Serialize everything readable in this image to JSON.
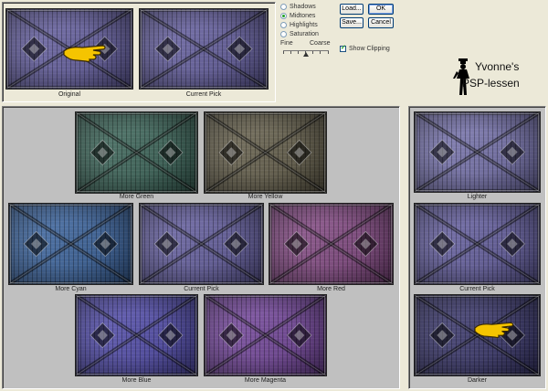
{
  "top": {
    "original_caption": "Original",
    "current_pick_caption": "Current Pick"
  },
  "controls": {
    "radios": [
      {
        "label": "Shadows",
        "selected": false
      },
      {
        "label": "Midtones",
        "selected": true
      },
      {
        "label": "Highlights",
        "selected": false
      },
      {
        "label": "Saturation",
        "selected": false
      }
    ],
    "buttons": {
      "load": "Load...",
      "ok": "OK",
      "save": "Save...",
      "cancel": "Cancel"
    },
    "slider": {
      "fine_label": "Fine",
      "coarse_label": "Coarse",
      "position": 0.5
    },
    "show_clipping": {
      "label": "Show Clipping",
      "checked": true
    }
  },
  "logo": {
    "line1": "Yvonne's",
    "line2": "PSP-lessen"
  },
  "variations": {
    "more_green": "More Green",
    "more_yellow": "More Yellow",
    "more_cyan": "More Cyan",
    "current_pick": "Current Pick",
    "more_red": "More Red",
    "more_blue": "More Blue",
    "more_magenta": "More Magenta"
  },
  "brightness": {
    "lighter": "Lighter",
    "current_pick": "Current Pick",
    "darker": "Darker"
  },
  "colors": {
    "original": "#6a64a8",
    "current": "#6a64a8",
    "green": "#3f6b5e",
    "yellow": "#6b6550",
    "cyan": "#3e69a6",
    "red": "#8a4d8a",
    "blue": "#5650b4",
    "magenta": "#7a4aa4",
    "lighter": "#7d79b6",
    "darker": "#3d3a72"
  }
}
